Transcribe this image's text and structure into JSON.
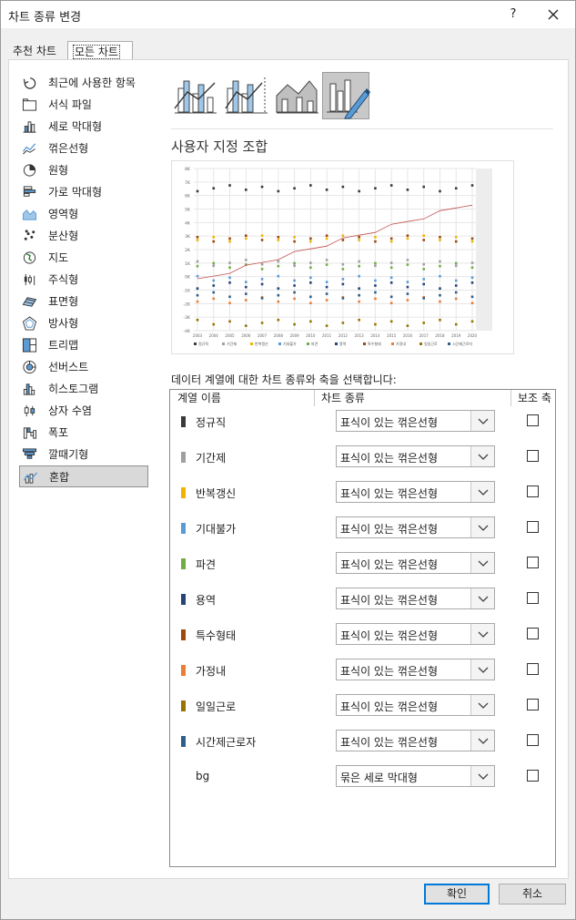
{
  "window": {
    "title": "차트 종류 변경",
    "help": "?",
    "close_glyph": "✕"
  },
  "tabs": [
    {
      "label": "추천 차트"
    },
    {
      "label": "모든 차트"
    }
  ],
  "chart_types": [
    {
      "label": "최근에 사용한 항목",
      "icon": "recent-icon"
    },
    {
      "label": "서식 파일",
      "icon": "folder-icon"
    },
    {
      "label": "세로 막대형",
      "icon": "column-chart-icon"
    },
    {
      "label": "꺾은선형",
      "icon": "line-chart-icon"
    },
    {
      "label": "원형",
      "icon": "pie-chart-icon"
    },
    {
      "label": "가로 막대형",
      "icon": "bar-chart-icon"
    },
    {
      "label": "영역형",
      "icon": "area-chart-icon"
    },
    {
      "label": "분산형",
      "icon": "scatter-chart-icon"
    },
    {
      "label": "지도",
      "icon": "map-chart-icon"
    },
    {
      "label": "주식형",
      "icon": "stock-chart-icon"
    },
    {
      "label": "표면형",
      "icon": "surface-chart-icon"
    },
    {
      "label": "방사형",
      "icon": "radar-chart-icon"
    },
    {
      "label": "트리맵",
      "icon": "treemap-icon"
    },
    {
      "label": "선버스트",
      "icon": "sunburst-icon"
    },
    {
      "label": "히스토그램",
      "icon": "histogram-icon"
    },
    {
      "label": "상자 수염",
      "icon": "box-whisker-icon"
    },
    {
      "label": "폭포",
      "icon": "waterfall-icon"
    },
    {
      "label": "깔때기형",
      "icon": "funnel-icon"
    },
    {
      "label": "혼합",
      "icon": "combo-chart-icon",
      "selected": true
    }
  ],
  "combo_title": "사용자 지정 조합",
  "instruction": "데이터 계열에 대한 차트 종류와 축을 선택합니다:",
  "columns": {
    "series": "계열 이름",
    "chart_type": "차트 종류",
    "secondary": "보조 축"
  },
  "series": [
    {
      "name": "정규직",
      "color": "#3a3a3a",
      "chart_type": "표식이 있는 꺾은선형"
    },
    {
      "name": "기간제",
      "color": "#a0a0a0",
      "chart_type": "표식이 있는 꺾은선형"
    },
    {
      "name": "반복갱신",
      "color": "#f0b400",
      "chart_type": "표식이 있는 꺾은선형"
    },
    {
      "name": "기대불가",
      "color": "#5b9bd5",
      "chart_type": "표식이 있는 꺾은선형"
    },
    {
      "name": "파견",
      "color": "#70ad47",
      "chart_type": "표식이 있는 꺾은선형"
    },
    {
      "name": "용역",
      "color": "#264478",
      "chart_type": "표식이 있는 꺾은선형"
    },
    {
      "name": "특수형태",
      "color": "#9e480e",
      "chart_type": "표식이 있는 꺾은선형"
    },
    {
      "name": "가정내",
      "color": "#ed7d31",
      "chart_type": "표식이 있는 꺾은선형"
    },
    {
      "name": "일일근로",
      "color": "#997300",
      "chart_type": "표식이 있는 꺾은선형"
    },
    {
      "name": "시간제근로자",
      "color": "#2e5f8a",
      "chart_type": "표식이 있는 꺾은선형"
    },
    {
      "name": "bg",
      "color": "",
      "chart_type": "묶은 세로 막대형"
    }
  ],
  "preview": {
    "y_ticks": [
      "8K",
      "7K",
      "6K",
      "5K",
      "4K",
      "3K",
      "2K",
      "1K",
      "0K",
      "-1K",
      "-2K",
      "-3K",
      "-4K"
    ],
    "x_ticks": [
      "2003",
      "2004",
      "2005",
      "2006",
      "2007",
      "2008",
      "2009",
      "2010",
      "2011",
      "2012",
      "2013",
      "2014",
      "2015",
      "2016",
      "2017",
      "2018",
      "2019",
      "2020"
    ],
    "legend": [
      "정규직",
      "기간제",
      "반복갱신",
      "기대불가",
      "파견",
      "용역",
      "특수형태",
      "가정내",
      "일일근로",
      "시간제근로자"
    ]
  },
  "buttons": {
    "ok": "확인",
    "cancel": "취소"
  },
  "accent": "#0078d7"
}
